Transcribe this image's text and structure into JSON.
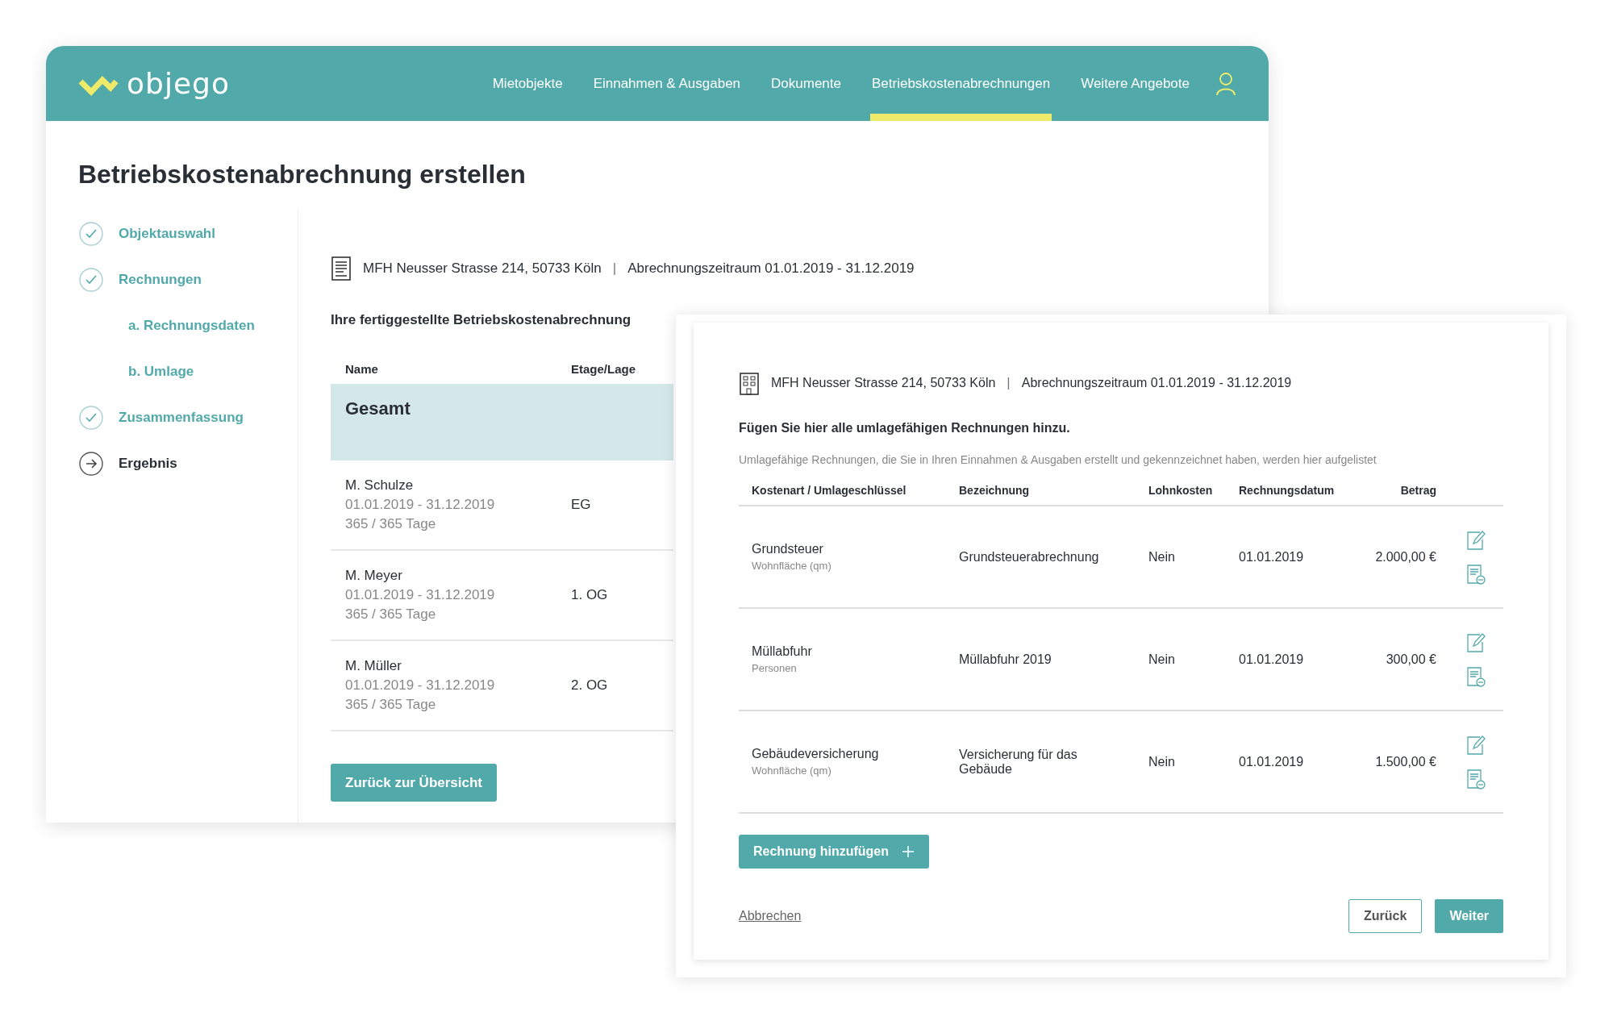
{
  "app": {
    "logo": "objego",
    "nav": [
      {
        "label": "Mietobjekte",
        "selected": false
      },
      {
        "label": "Einnahmen & Ausgaben",
        "selected": false
      },
      {
        "label": "Dokumente",
        "selected": false
      },
      {
        "label": "Betriebskostenabrechnungen",
        "selected": true
      },
      {
        "label": "Weitere Angebote",
        "selected": false
      }
    ],
    "title": "Betriebskostenabrechnung erstellen",
    "steps": [
      {
        "label": "Objektauswahl",
        "current": false
      },
      {
        "label": "Rechnungen",
        "current": false,
        "children": [
          {
            "label": "a. Rechnungsdaten"
          },
          {
            "label": "b. Umlage"
          }
        ]
      },
      {
        "label": "Zusammenfassung",
        "current": false
      },
      {
        "label": "Ergebnis",
        "current": true
      }
    ],
    "property": "MFH Neusser Strasse 214, 50733 Köln",
    "separator": "|",
    "period": "Abrechnungszeitraum 01.01.2019 - 31.12.2019",
    "section_title": "Ihre fertiggestellte Betriebskostenabrechnung",
    "table": {
      "columns": [
        "Name",
        "Etage/Lage"
      ],
      "total": "Gesamt",
      "rows": [
        {
          "name": "M. Schulze",
          "period": "01.01.2019 - 31.12.2019",
          "days": "365 / 365 Tage",
          "floor": "EG"
        },
        {
          "name": "M. Meyer",
          "period": "01.01.2019 - 31.12.2019",
          "days": "365 / 365 Tage",
          "floor": "1. OG"
        },
        {
          "name": "M. Müller",
          "period": "01.01.2019 - 31.12.2019",
          "days": "365 / 365 Tage",
          "floor": "2. OG"
        }
      ]
    },
    "back_button": "Zurück zur Übersicht"
  },
  "dialog": {
    "property": "MFH Neusser Strasse 214, 50733 Köln",
    "separator": "|",
    "period": "Abrechnungszeitraum 01.01.2019 - 31.12.2019",
    "heading": "Fügen Sie hier alle umlagefähigen Rechnungen hinzu.",
    "description": "Umlagefähige Rechnungen, die Sie in Ihren Einnahmen & Ausgaben erstellt und gekennzeichnet haben, werden hier aufgelistet",
    "columns": [
      "Kostenart / Umlageschlüssel",
      "Bezeichnung",
      "Lohnkosten",
      "Rechnungsdatum",
      "Betrag"
    ],
    "rows": [
      {
        "type": "Grundsteuer",
        "key": "Wohnfläche (qm)",
        "name": "Grundsteuerabrechnung",
        "wages": "Nein",
        "date": "01.01.2019",
        "amount": "2.000,00 €"
      },
      {
        "type": "Müllabfuhr",
        "key": "Personen",
        "name": "Müllabfuhr 2019",
        "wages": "Nein",
        "date": "01.01.2019",
        "amount": "300,00 €"
      },
      {
        "type": "Gebäudeversicherung",
        "key": "Wohnfläche (qm)",
        "name": "Versicherung für das Gebäude",
        "wages": "Nein",
        "date": "01.01.2019",
        "amount": "1.500,00 €"
      }
    ],
    "add_button": "Rechnung hinzufügen",
    "cancel": "Abbrechen",
    "back": "Zurück",
    "next": "Weiter"
  }
}
